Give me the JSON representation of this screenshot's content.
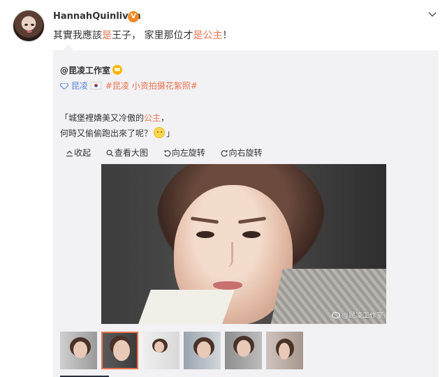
{
  "post": {
    "author": "HannahQuinlivan",
    "verified_badge": "V",
    "text_parts": [
      "其實我應該",
      "是",
      "王子， 家里那位才",
      "是",
      "公主",
      "！"
    ]
  },
  "repost": {
    "author": "@昆凌工作室",
    "tags": {
      "user_link": "昆凌",
      "topic_1": "#昆凌 小资拍摄花絮照#",
      "topic_1_a": "#昆凌",
      "topic_1_b": "小资拍摄花絮照#"
    },
    "quote_line1_parts": [
      "「城堡裡嬌美又冷傲的",
      "公主",
      "，"
    ],
    "quote_line2_parts": [
      "何時又偷偷跑出來了呢？",
      "」"
    ],
    "actions": [
      {
        "label": "收起",
        "icon": "collapse-icon"
      },
      {
        "label": "查看大图",
        "icon": "search-icon"
      },
      {
        "label": "向左旋转",
        "icon": "rotate-left-icon"
      },
      {
        "label": "向右旋转",
        "icon": "rotate-right-icon"
      }
    ],
    "watermark": "@昆凌工作室",
    "thumbnail_count": 6,
    "selected_thumbnail": 2
  },
  "colors": {
    "highlight": "#eb7350",
    "link_blue": "#5d8ad8",
    "repost_bg": "#f2f2f5",
    "verified": "#f08a24"
  }
}
